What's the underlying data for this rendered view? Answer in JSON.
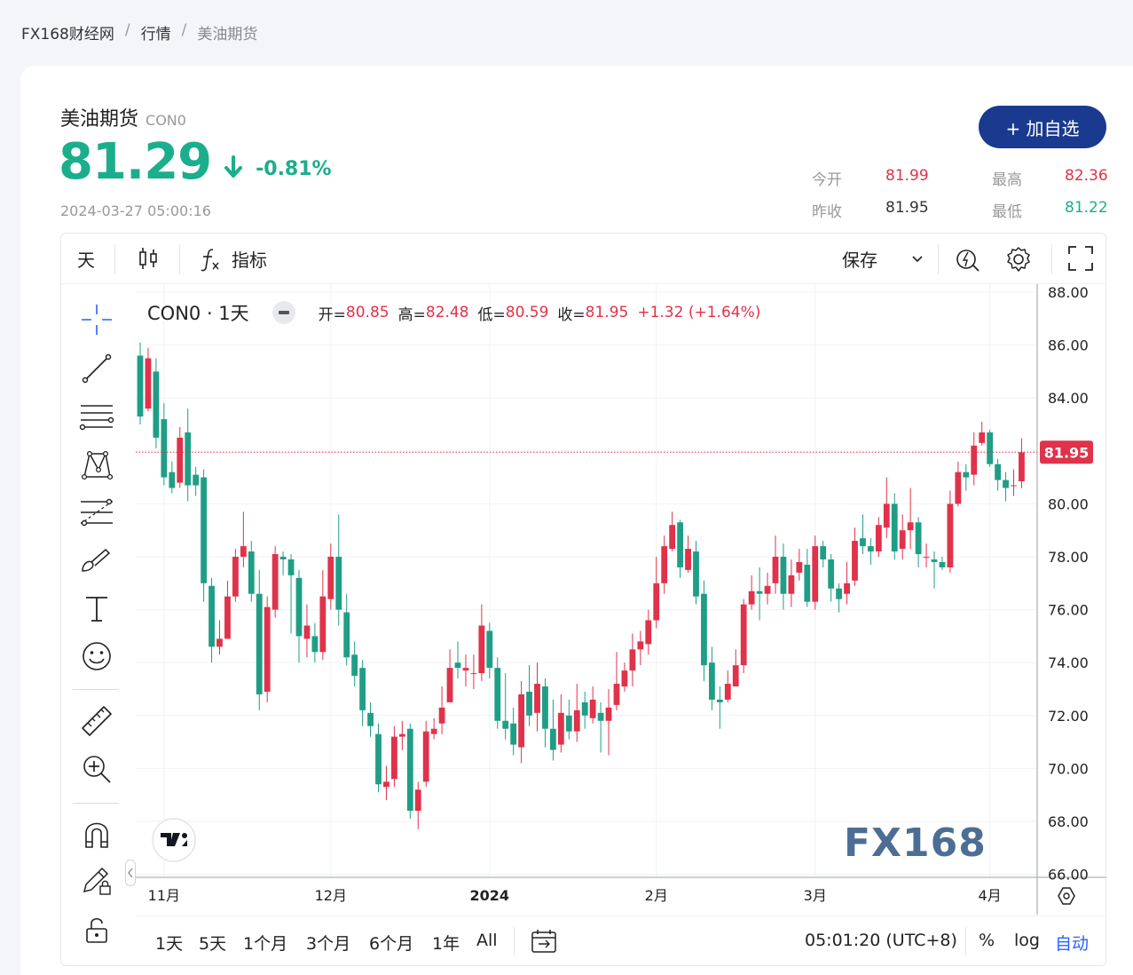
{
  "breadcrumb": {
    "site": "FX168财经网",
    "section": "行情",
    "current": "美油期货"
  },
  "header": {
    "name": "美油期货",
    "code": "CON0",
    "price": "81.29",
    "change_pct": "-0.81%",
    "timestamp": "2024-03-27 05:00:16",
    "add_button": "+ 加自选"
  },
  "stats": {
    "open_label": "今开",
    "open": "81.99",
    "high_label": "最高",
    "high": "82.36",
    "prev_label": "昨收",
    "prev": "81.95",
    "low_label": "最低",
    "low": "81.22"
  },
  "toolbar": {
    "interval": "天",
    "indicators": "指标",
    "save": "保存"
  },
  "legend": {
    "symbol": "CON0 · 1天",
    "open_label": "开=",
    "open": "80.85",
    "high_label": "高=",
    "high": "82.48",
    "low_label": "低=",
    "low": "80.59",
    "close_label": "收=",
    "close": "81.95",
    "change": "+1.32 (+1.64%)"
  },
  "colors": {
    "up": "#e0324a",
    "down": "#1f9e86",
    "accent": "#1a3a8f",
    "blue": "#2962ff"
  },
  "chart_data": {
    "type": "candlestick",
    "y_ticks": [
      "88.00",
      "86.00",
      "84.00",
      "82.00",
      "80.00",
      "78.00",
      "76.00",
      "74.00",
      "72.00",
      "70.00",
      "68.00",
      "66.00"
    ],
    "ylim": [
      66,
      88
    ],
    "x_ticks": [
      {
        "label": "11月",
        "index": 3
      },
      {
        "label": "12月",
        "index": 24
      },
      {
        "label": "2024",
        "index": 44
      },
      {
        "label": "2月",
        "index": 65
      },
      {
        "label": "3月",
        "index": 85
      },
      {
        "label": "4月",
        "index": 107
      }
    ],
    "last_price_label": "81.95",
    "last_price": 81.95,
    "candles": [
      [
        85.6,
        83.3,
        86.1,
        83.0
      ],
      [
        83.6,
        85.5,
        85.9,
        83.5
      ],
      [
        85.0,
        82.5,
        85.5,
        82.1
      ],
      [
        83.2,
        81.0,
        83.8,
        80.7
      ],
      [
        81.2,
        80.6,
        81.6,
        80.4
      ],
      [
        80.8,
        82.5,
        82.9,
        80.6
      ],
      [
        82.7,
        80.7,
        83.6,
        80.1
      ],
      [
        81.1,
        80.7,
        81.4,
        80.3
      ],
      [
        81.0,
        77.0,
        81.3,
        76.3
      ],
      [
        76.9,
        74.6,
        77.2,
        74.0
      ],
      [
        74.6,
        74.9,
        75.6,
        74.3
      ],
      [
        74.9,
        76.5,
        77.1,
        74.9
      ],
      [
        76.5,
        78.0,
        78.3,
        76.3
      ],
      [
        78.0,
        78.4,
        79.7,
        77.6
      ],
      [
        78.2,
        76.6,
        78.6,
        76.3
      ],
      [
        76.6,
        72.8,
        77.5,
        72.2
      ],
      [
        72.9,
        76.1,
        76.5,
        72.5
      ],
      [
        76.0,
        78.1,
        78.4,
        75.7
      ],
      [
        78.0,
        77.9,
        78.2,
        77.3
      ],
      [
        77.9,
        77.3,
        78.1,
        75.1
      ],
      [
        77.2,
        75.0,
        77.5,
        74.0
      ],
      [
        74.9,
        75.4,
        76.2,
        74.2
      ],
      [
        75.0,
        74.4,
        75.5,
        74.0
      ],
      [
        74.4,
        76.5,
        77.5,
        74.1
      ],
      [
        76.4,
        78.0,
        78.5,
        76.0
      ],
      [
        78.0,
        76.0,
        79.6,
        75.4
      ],
      [
        75.9,
        74.2,
        76.6,
        73.9
      ],
      [
        74.3,
        73.5,
        74.8,
        73.1
      ],
      [
        73.8,
        72.2,
        74.1,
        71.6
      ],
      [
        72.1,
        71.6,
        72.5,
        71.2
      ],
      [
        71.3,
        69.4,
        71.7,
        69.1
      ],
      [
        69.3,
        69.5,
        70.1,
        68.8
      ],
      [
        69.6,
        71.2,
        71.6,
        69.3
      ],
      [
        71.2,
        71.3,
        71.8,
        70.7
      ],
      [
        71.5,
        68.4,
        71.7,
        68.1
      ],
      [
        68.4,
        69.2,
        69.5,
        67.7
      ],
      [
        69.5,
        71.4,
        71.8,
        69.3
      ],
      [
        71.3,
        71.5,
        71.9,
        71.1
      ],
      [
        71.7,
        72.3,
        73.1,
        71.3
      ],
      [
        72.5,
        73.8,
        74.5,
        72.5
      ],
      [
        74.0,
        73.8,
        74.8,
        73.4
      ],
      [
        73.7,
        73.8,
        74.3,
        73.1
      ],
      [
        73.6,
        73.6,
        74.3,
        73.0
      ],
      [
        73.6,
        75.4,
        76.2,
        73.3
      ],
      [
        75.2,
        73.8,
        75.5,
        73.4
      ],
      [
        73.8,
        71.8,
        74.2,
        71.5
      ],
      [
        71.8,
        71.5,
        73.6,
        71.1
      ],
      [
        71.7,
        70.9,
        72.3,
        70.5
      ],
      [
        70.8,
        72.8,
        73.3,
        70.2
      ],
      [
        72.9,
        72.0,
        73.9,
        71.6
      ],
      [
        72.1,
        73.2,
        74.0,
        71.4
      ],
      [
        73.1,
        71.5,
        73.4,
        70.8
      ],
      [
        71.5,
        70.7,
        72.6,
        70.3
      ],
      [
        70.9,
        72.1,
        72.8,
        70.6
      ],
      [
        72.0,
        71.4,
        72.6,
        71.1
      ],
      [
        71.4,
        72.2,
        73.2,
        71.0
      ],
      [
        72.5,
        72.0,
        72.9,
        71.5
      ],
      [
        71.9,
        72.6,
        73.1,
        71.7
      ],
      [
        72.1,
        71.8,
        72.5,
        70.6
      ],
      [
        71.8,
        72.3,
        73.0,
        70.5
      ],
      [
        72.4,
        73.2,
        74.4,
        72.2
      ],
      [
        73.1,
        73.7,
        74.0,
        72.9
      ],
      [
        73.7,
        74.5,
        75.1,
        73.1
      ],
      [
        74.5,
        74.8,
        75.2,
        73.9
      ],
      [
        74.7,
        75.6,
        76.0,
        74.3
      ],
      [
        75.6,
        77.0,
        78.0,
        75.3
      ],
      [
        77.0,
        78.4,
        78.8,
        76.6
      ],
      [
        78.3,
        79.2,
        79.7,
        78.2
      ],
      [
        79.3,
        77.6,
        79.4,
        77.2
      ],
      [
        77.5,
        78.3,
        78.8,
        77.4
      ],
      [
        78.2,
        76.5,
        78.6,
        76.2
      ],
      [
        76.6,
        73.9,
        77.1,
        73.3
      ],
      [
        74.0,
        72.6,
        74.6,
        72.2
      ],
      [
        72.6,
        72.5,
        73.1,
        71.5
      ],
      [
        72.6,
        73.2,
        73.7,
        72.5
      ],
      [
        73.1,
        73.9,
        74.5,
        73.1
      ],
      [
        73.9,
        76.2,
        76.4,
        73.6
      ],
      [
        76.2,
        76.7,
        77.3,
        76.0
      ],
      [
        76.7,
        76.6,
        77.6,
        75.6
      ],
      [
        76.6,
        76.9,
        77.4,
        76.2
      ],
      [
        77.0,
        78.0,
        78.8,
        76.6
      ],
      [
        78.0,
        76.6,
        78.5,
        76.0
      ],
      [
        76.6,
        77.3,
        77.9,
        76.1
      ],
      [
        77.4,
        77.8,
        78.3,
        77.1
      ],
      [
        77.7,
        76.3,
        78.3,
        76.1
      ],
      [
        76.3,
        78.4,
        78.8,
        76.0
      ],
      [
        78.4,
        77.9,
        78.6,
        77.6
      ],
      [
        77.9,
        76.8,
        78.1,
        76.3
      ],
      [
        76.8,
        76.4,
        77.0,
        75.9
      ],
      [
        76.6,
        77.0,
        77.8,
        76.2
      ],
      [
        77.1,
        78.6,
        79.1,
        76.9
      ],
      [
        78.7,
        78.4,
        79.6,
        78.1
      ],
      [
        78.4,
        78.2,
        78.7,
        77.7
      ],
      [
        78.2,
        79.2,
        79.5,
        78.0
      ],
      [
        79.1,
        80.0,
        81.0,
        78.7
      ],
      [
        80.0,
        78.2,
        80.4,
        77.9
      ],
      [
        78.3,
        79.0,
        79.6,
        77.9
      ],
      [
        79.0,
        79.3,
        80.6,
        78.3
      ],
      [
        79.3,
        78.1,
        79.5,
        77.6
      ],
      [
        78.0,
        78.0,
        78.5,
        77.6
      ],
      [
        77.9,
        77.8,
        78.2,
        76.8
      ],
      [
        77.8,
        77.6,
        78.0,
        77.5
      ],
      [
        77.6,
        80.0,
        80.5,
        77.4
      ],
      [
        80.0,
        81.2,
        81.6,
        79.9
      ],
      [
        81.2,
        81.0,
        81.5,
        80.5
      ],
      [
        81.1,
        82.2,
        82.7,
        80.7
      ],
      [
        82.3,
        82.7,
        83.1,
        82.2
      ],
      [
        82.7,
        81.5,
        82.8,
        81.4
      ],
      [
        81.5,
        80.9,
        81.7,
        80.5
      ],
      [
        80.9,
        80.6,
        81.2,
        80.1
      ],
      [
        80.7,
        80.7,
        81.3,
        80.3
      ],
      [
        80.85,
        81.95,
        82.48,
        80.59
      ]
    ]
  },
  "bottombar": {
    "ranges": [
      "1天",
      "5天",
      "1个月",
      "3个月",
      "6个月",
      "1年",
      "All"
    ],
    "clock": "05:01:20 (UTC+8)",
    "percent": "%",
    "log": "log",
    "auto": "自动"
  },
  "watermark": "FX168"
}
